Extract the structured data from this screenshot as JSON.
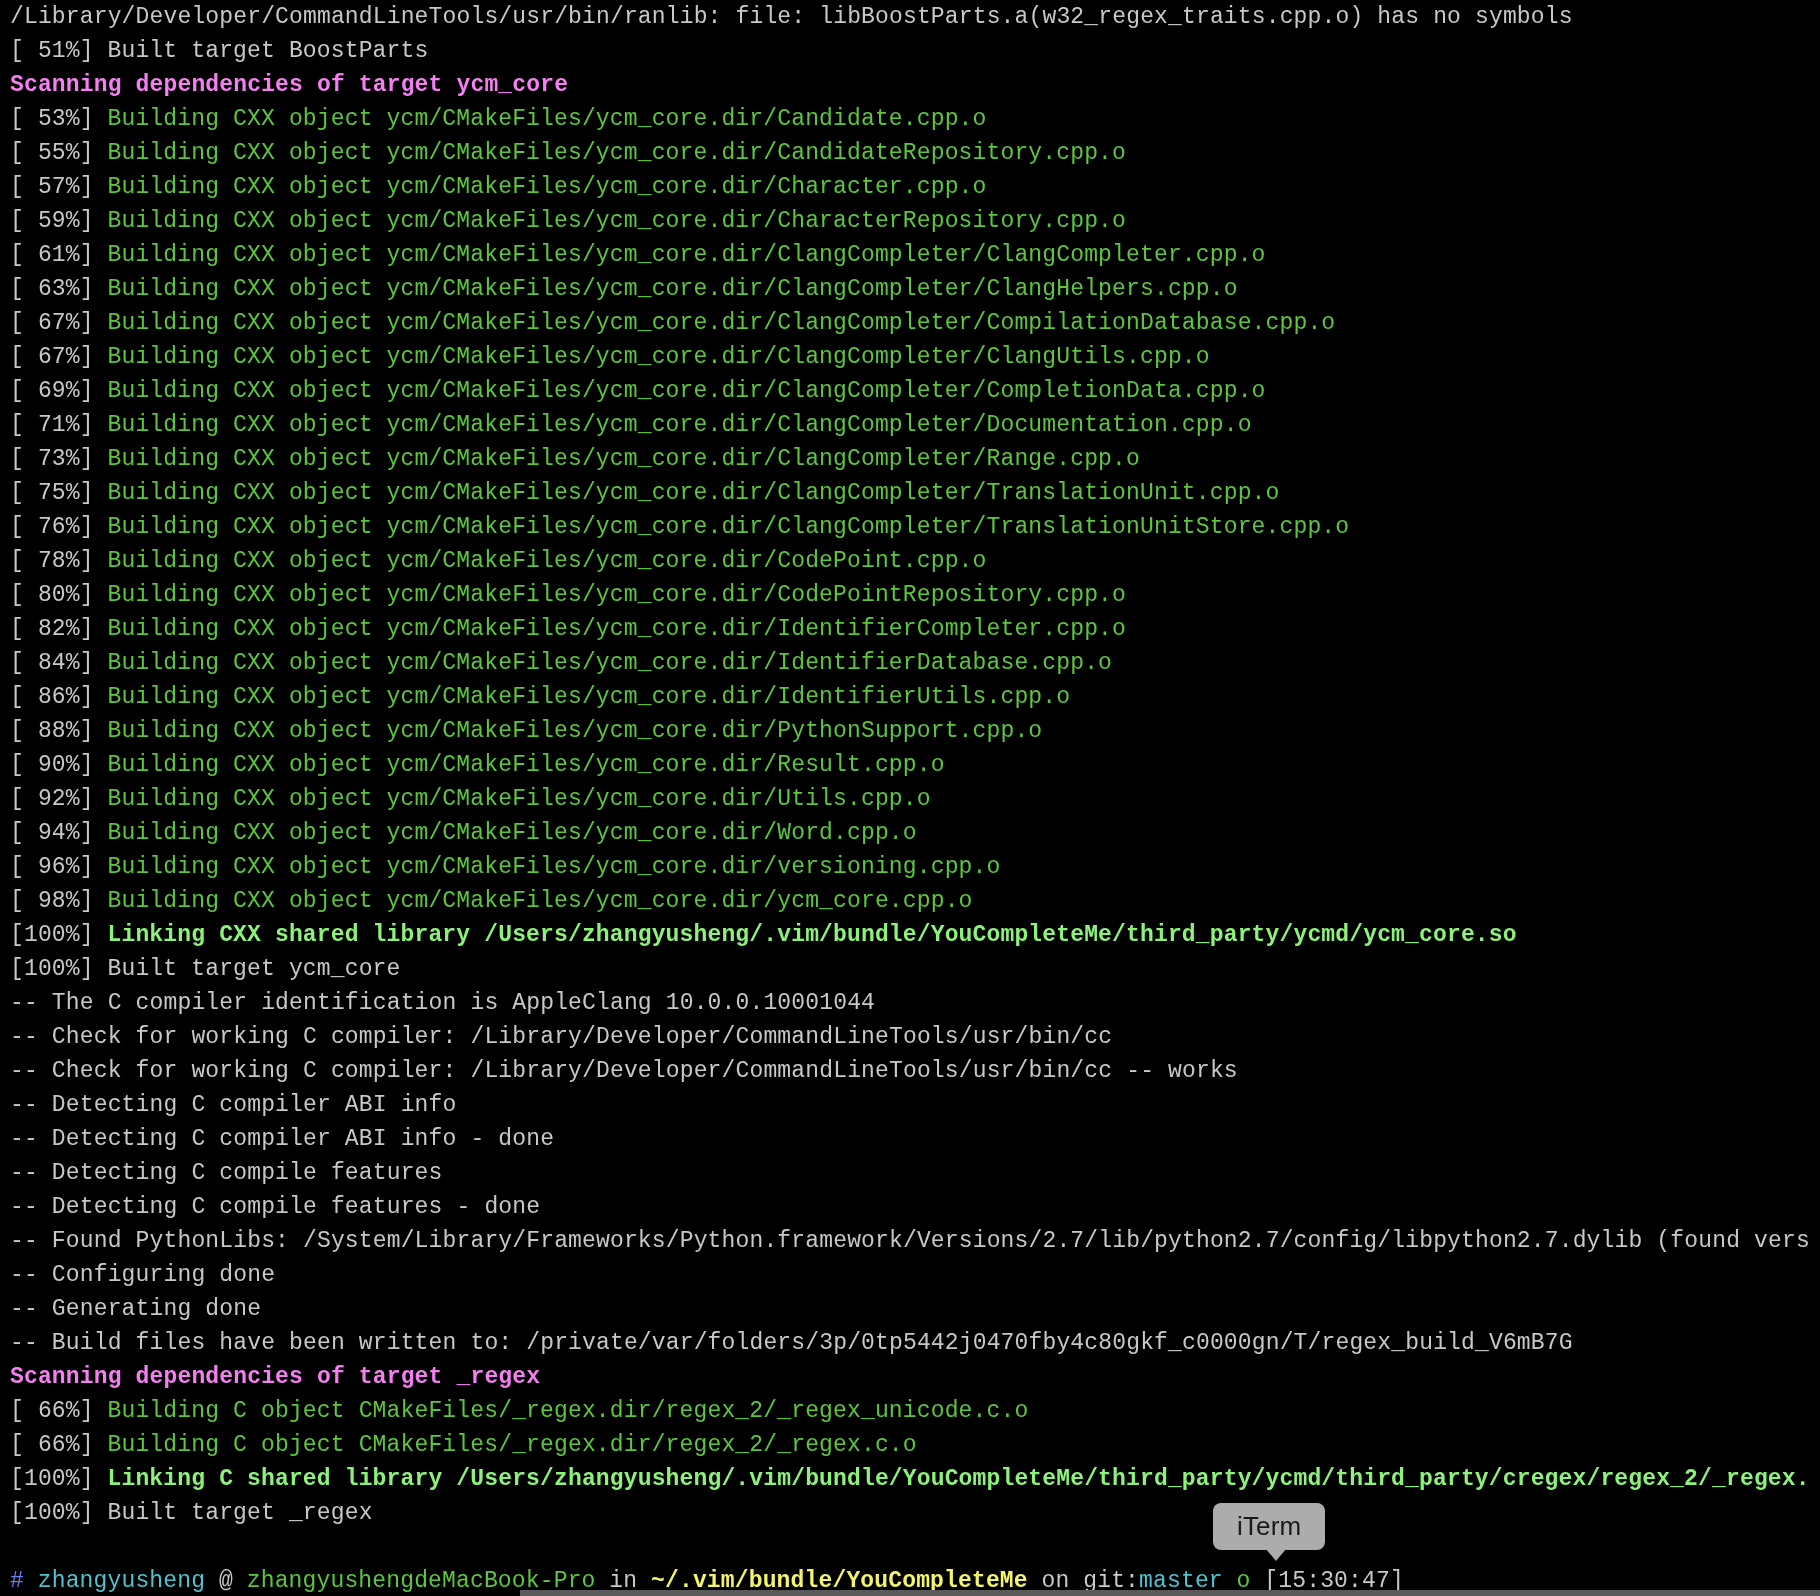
{
  "lines": [
    {
      "kind": "plain",
      "text": "/Library/Developer/CommandLineTools/usr/bin/ranlib: file: libBoostParts.a(w32_regex_traits.cpp.o) has no symbols"
    },
    {
      "progress": "[ 51%]",
      "kind": "plain",
      "text": "Built target BoostParts"
    },
    {
      "kind": "scan",
      "text": "Scanning dependencies of target ycm_core"
    },
    {
      "progress": "[ 53%]",
      "kind": "build",
      "text": "Building CXX object ycm/CMakeFiles/ycm_core.dir/Candidate.cpp.o"
    },
    {
      "progress": "[ 55%]",
      "kind": "build",
      "text": "Building CXX object ycm/CMakeFiles/ycm_core.dir/CandidateRepository.cpp.o"
    },
    {
      "progress": "[ 57%]",
      "kind": "build",
      "text": "Building CXX object ycm/CMakeFiles/ycm_core.dir/Character.cpp.o"
    },
    {
      "progress": "[ 59%]",
      "kind": "build",
      "text": "Building CXX object ycm/CMakeFiles/ycm_core.dir/CharacterRepository.cpp.o"
    },
    {
      "progress": "[ 61%]",
      "kind": "build",
      "text": "Building CXX object ycm/CMakeFiles/ycm_core.dir/ClangCompleter/ClangCompleter.cpp.o"
    },
    {
      "progress": "[ 63%]",
      "kind": "build",
      "text": "Building CXX object ycm/CMakeFiles/ycm_core.dir/ClangCompleter/ClangHelpers.cpp.o"
    },
    {
      "progress": "[ 67%]",
      "kind": "build",
      "text": "Building CXX object ycm/CMakeFiles/ycm_core.dir/ClangCompleter/CompilationDatabase.cpp.o"
    },
    {
      "progress": "[ 67%]",
      "kind": "build",
      "text": "Building CXX object ycm/CMakeFiles/ycm_core.dir/ClangCompleter/ClangUtils.cpp.o"
    },
    {
      "progress": "[ 69%]",
      "kind": "build",
      "text": "Building CXX object ycm/CMakeFiles/ycm_core.dir/ClangCompleter/CompletionData.cpp.o"
    },
    {
      "progress": "[ 71%]",
      "kind": "build",
      "text": "Building CXX object ycm/CMakeFiles/ycm_core.dir/ClangCompleter/Documentation.cpp.o"
    },
    {
      "progress": "[ 73%]",
      "kind": "build",
      "text": "Building CXX object ycm/CMakeFiles/ycm_core.dir/ClangCompleter/Range.cpp.o"
    },
    {
      "progress": "[ 75%]",
      "kind": "build",
      "text": "Building CXX object ycm/CMakeFiles/ycm_core.dir/ClangCompleter/TranslationUnit.cpp.o"
    },
    {
      "progress": "[ 76%]",
      "kind": "build",
      "text": "Building CXX object ycm/CMakeFiles/ycm_core.dir/ClangCompleter/TranslationUnitStore.cpp.o"
    },
    {
      "progress": "[ 78%]",
      "kind": "build",
      "text": "Building CXX object ycm/CMakeFiles/ycm_core.dir/CodePoint.cpp.o"
    },
    {
      "progress": "[ 80%]",
      "kind": "build",
      "text": "Building CXX object ycm/CMakeFiles/ycm_core.dir/CodePointRepository.cpp.o"
    },
    {
      "progress": "[ 82%]",
      "kind": "build",
      "text": "Building CXX object ycm/CMakeFiles/ycm_core.dir/IdentifierCompleter.cpp.o"
    },
    {
      "progress": "[ 84%]",
      "kind": "build",
      "text": "Building CXX object ycm/CMakeFiles/ycm_core.dir/IdentifierDatabase.cpp.o"
    },
    {
      "progress": "[ 86%]",
      "kind": "build",
      "text": "Building CXX object ycm/CMakeFiles/ycm_core.dir/IdentifierUtils.cpp.o"
    },
    {
      "progress": "[ 88%]",
      "kind": "build",
      "text": "Building CXX object ycm/CMakeFiles/ycm_core.dir/PythonSupport.cpp.o"
    },
    {
      "progress": "[ 90%]",
      "kind": "build",
      "text": "Building CXX object ycm/CMakeFiles/ycm_core.dir/Result.cpp.o"
    },
    {
      "progress": "[ 92%]",
      "kind": "build",
      "text": "Building CXX object ycm/CMakeFiles/ycm_core.dir/Utils.cpp.o"
    },
    {
      "progress": "[ 94%]",
      "kind": "build",
      "text": "Building CXX object ycm/CMakeFiles/ycm_core.dir/Word.cpp.o"
    },
    {
      "progress": "[ 96%]",
      "kind": "build",
      "text": "Building CXX object ycm/CMakeFiles/ycm_core.dir/versioning.cpp.o"
    },
    {
      "progress": "[ 98%]",
      "kind": "build",
      "text": "Building CXX object ycm/CMakeFiles/ycm_core.dir/ycm_core.cpp.o"
    },
    {
      "progress": "[100%]",
      "kind": "link",
      "text": "Linking CXX shared library /Users/zhangyusheng/.vim/bundle/YouCompleteMe/third_party/ycmd/ycm_core.so"
    },
    {
      "progress": "[100%]",
      "kind": "plain",
      "text": "Built target ycm_core"
    },
    {
      "kind": "plain",
      "text": "-- The C compiler identification is AppleClang 10.0.0.10001044"
    },
    {
      "kind": "plain",
      "text": "-- Check for working C compiler: /Library/Developer/CommandLineTools/usr/bin/cc"
    },
    {
      "kind": "plain",
      "text": "-- Check for working C compiler: /Library/Developer/CommandLineTools/usr/bin/cc -- works"
    },
    {
      "kind": "plain",
      "text": "-- Detecting C compiler ABI info"
    },
    {
      "kind": "plain",
      "text": "-- Detecting C compiler ABI info - done"
    },
    {
      "kind": "plain",
      "text": "-- Detecting C compile features"
    },
    {
      "kind": "plain",
      "text": "-- Detecting C compile features - done"
    },
    {
      "kind": "plain",
      "text": "-- Found PythonLibs: /System/Library/Frameworks/Python.framework/Versions/2.7/lib/python2.7/config/libpython2.7.dylib (found vers"
    },
    {
      "kind": "plain",
      "text": "-- Configuring done"
    },
    {
      "kind": "plain",
      "text": "-- Generating done"
    },
    {
      "kind": "plain",
      "text": "-- Build files have been written to: /private/var/folders/3p/0tp5442j0470fby4c80gkf_c0000gn/T/regex_build_V6mB7G"
    },
    {
      "kind": "scan",
      "text": "Scanning dependencies of target _regex"
    },
    {
      "progress": "[ 66%]",
      "kind": "build",
      "text": "Building C object CMakeFiles/_regex.dir/regex_2/_regex_unicode.c.o"
    },
    {
      "progress": "[ 66%]",
      "kind": "build",
      "text": "Building C object CMakeFiles/_regex.dir/regex_2/_regex.c.o"
    },
    {
      "progress": "[100%]",
      "kind": "link",
      "text": "Linking C shared library /Users/zhangyusheng/.vim/bundle/YouCompleteMe/third_party/ycmd/third_party/cregex/regex_2/_regex."
    },
    {
      "progress": "[100%]",
      "kind": "plain",
      "text": "Built target _regex"
    }
  ],
  "prompt": [
    {
      "kind": "hash",
      "text": "#"
    },
    {
      "kind": "user",
      "text": "zhangyusheng"
    },
    {
      "kind": "plain",
      "text": "@"
    },
    {
      "kind": "host",
      "text": "zhangyushengdeMacBook-Pro"
    },
    {
      "kind": "plain",
      "text": "in"
    },
    {
      "kind": "path",
      "text": "~/.vim/bundle/YouCompleteMe"
    },
    {
      "kind": "plain",
      "text": "on"
    },
    {
      "kind": "plain",
      "text": "git:"
    },
    {
      "kind": "branch",
      "text": "master"
    },
    {
      "kind": "dirty",
      "text": "o"
    },
    {
      "kind": "plain",
      "text": "[15:30:47]"
    }
  ],
  "tooltip": {
    "text": "iTerm"
  }
}
